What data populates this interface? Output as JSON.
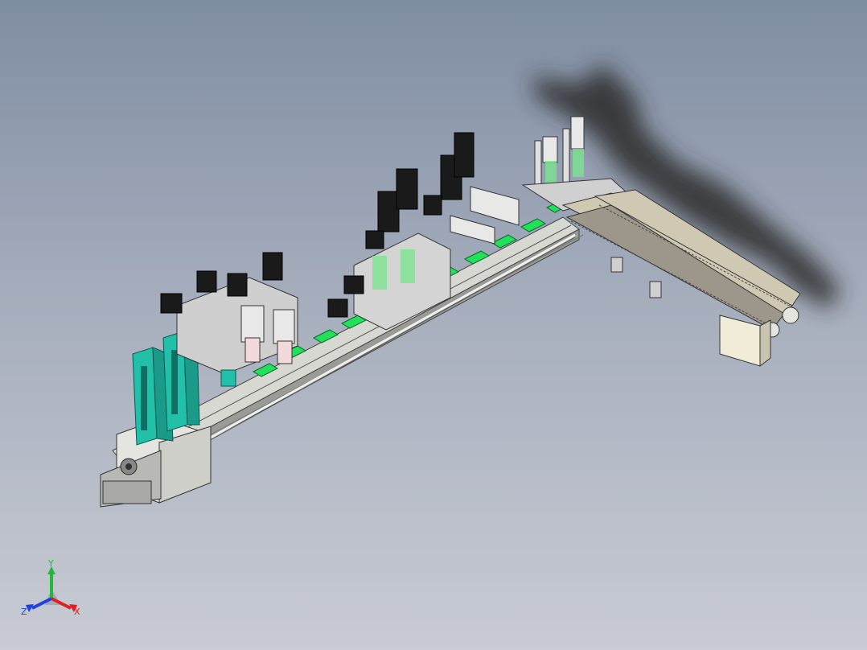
{
  "viewport": {
    "background_top": "#7f8da2",
    "background_bottom": "#c8cbd3"
  },
  "colors": {
    "accent_green": "#22e05a",
    "teal_rack": "#22c0a8",
    "motor_black": "#1a1a1a",
    "frame_gray": "#d6d6d0",
    "conveyor_beige": "#cfc9b4",
    "shadow": "#2a2a2a"
  },
  "triad": {
    "y_label": "Y",
    "x_label": "X",
    "z_label": "Z",
    "y_color": "#22b83a",
    "x_color": "#e02020",
    "z_color": "#2040e0"
  }
}
